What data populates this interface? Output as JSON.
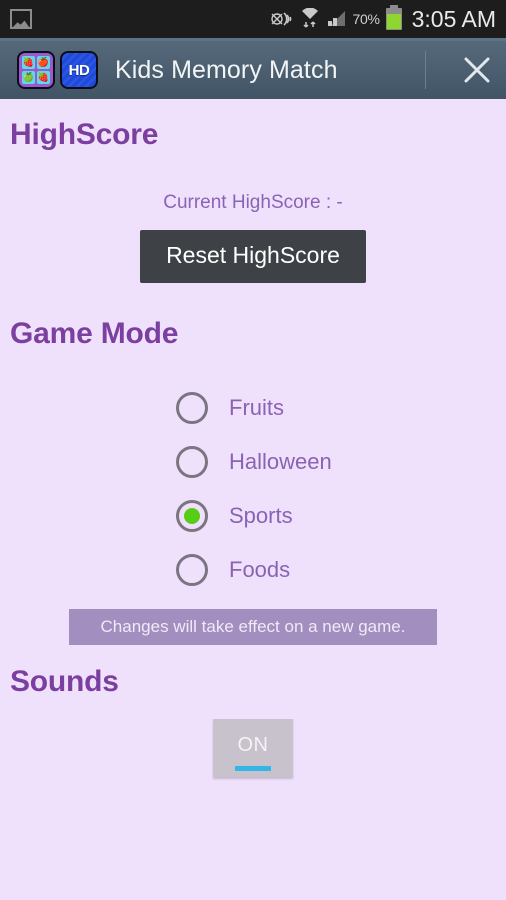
{
  "status_bar": {
    "notification_icon": "image-icon",
    "icons": [
      "location-icon",
      "wifi-icon",
      "cellular-signal-icon"
    ],
    "battery_percent": "70%",
    "battery_icon": "battery-icon",
    "time": "3:05 AM"
  },
  "title_bar": {
    "app_icon": "app-grid-icon",
    "hd_badge": "HD",
    "title": "Kids Memory Match",
    "close_icon": "close-x-icon"
  },
  "highscore": {
    "heading": "HighScore",
    "current_label": "Current HighScore : -",
    "reset_button": "Reset HighScore"
  },
  "game_mode": {
    "heading": "Game Mode",
    "options": [
      {
        "label": "Fruits",
        "selected": false
      },
      {
        "label": "Halloween",
        "selected": false
      },
      {
        "label": "Sports",
        "selected": true
      },
      {
        "label": "Foods",
        "selected": false
      }
    ],
    "notice": "Changes will take effect on a new game."
  },
  "sounds": {
    "heading": "Sounds",
    "toggle_label": "ON",
    "toggle_state": "on"
  },
  "colors": {
    "background": "#efe1fb",
    "heading_purple": "#7b3fa0",
    "body_purple": "#8a63b5",
    "titlebar": "#4c5f71",
    "status_bar": "#1d1d1d",
    "reset_button": "#3e4247",
    "notice_bg": "#a38fbf",
    "radio_selected": "#57cd16",
    "toggle_accent": "#33b5e5",
    "battery_green": "#8fd62e"
  }
}
